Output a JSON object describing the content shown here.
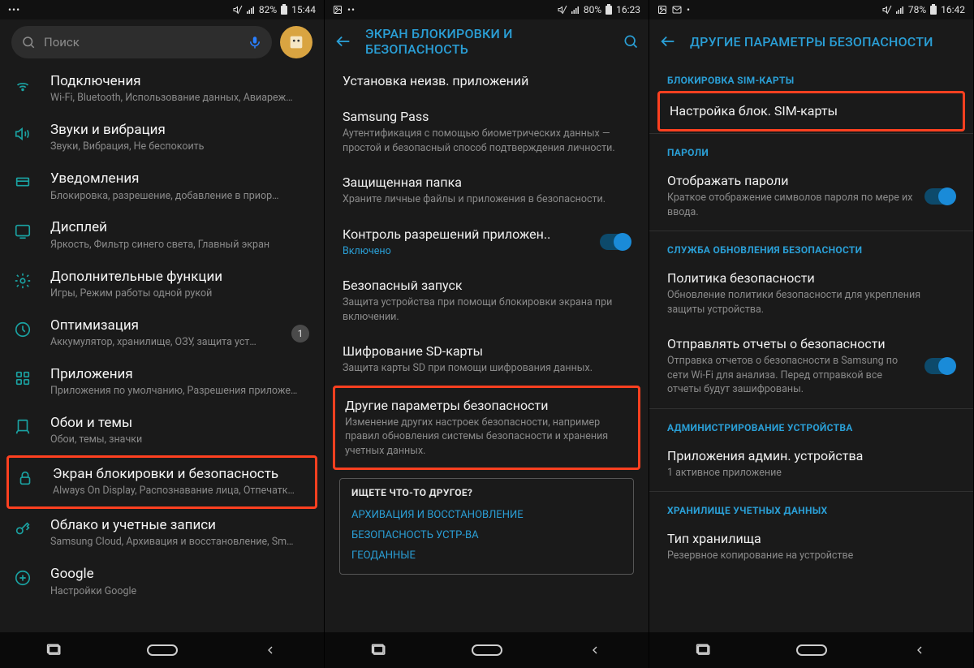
{
  "phone1": {
    "status": {
      "battery": "82%",
      "time": "15:44"
    },
    "search_placeholder": "Поиск",
    "items": [
      {
        "title": "Подключения",
        "sub": "Wi-Fi, Bluetooth, Использование данных, Авиареж…"
      },
      {
        "title": "Звуки и вибрация",
        "sub": "Звуки, Вибрация, Не беспокоить"
      },
      {
        "title": "Уведомления",
        "sub": "Блокировка, разрешение, добавление в приор…"
      },
      {
        "title": "Дисплей",
        "sub": "Яркость, Фильтр синего света, Главный экран"
      },
      {
        "title": "Дополнительные функции",
        "sub": "Игры, Режим работы одной рукой"
      },
      {
        "title": "Оптимизация",
        "sub": "Аккумулятор, хранилище, ОЗУ, защита уст…",
        "badge": "1"
      },
      {
        "title": "Приложения",
        "sub": "Приложения по умолчанию, Разрешения приложе…"
      },
      {
        "title": "Обои и темы",
        "sub": "Обои, темы, значки"
      },
      {
        "title": "Экран блокировки и безопасность",
        "sub": "Always On Display, Распознавание лица, Отпечатк…",
        "hl": true
      },
      {
        "title": "Облако и учетные записи",
        "sub": "Samsung Cloud, Архивация и восстановление, Sm…"
      },
      {
        "title": "Google",
        "sub": "Настройки Google"
      }
    ]
  },
  "phone2": {
    "status": {
      "battery": "80%",
      "time": "16:23"
    },
    "title": "ЭКРАН БЛОКИРОВКИ И БЕЗОПАСНОСТЬ",
    "items": [
      {
        "title": "Установка неизв. приложений"
      },
      {
        "title": "Samsung Pass",
        "sub": "Аутентификация с помощью биометрических данных — простой и безопасный способ подтверждения личности."
      },
      {
        "title": "Защищенная папка",
        "sub": "Храните личные файлы и приложения в безопасности."
      },
      {
        "title": "Контроль разрешений приложен..",
        "sub": "Включено",
        "sub_blue": true,
        "toggle": true
      },
      {
        "title": "Безопасный запуск",
        "sub": "Защита устройства при помощи блокировки экрана при включении."
      },
      {
        "title": "Шифрование SD-карты",
        "sub": "Защита карты SD при помощи шифрования данных."
      },
      {
        "title": "Другие параметры безопасности",
        "sub": "Изменение других настроек безопасности, например правил обновления системы безопасности и хранения учетных данных.",
        "hl": true
      }
    ],
    "other_box": {
      "title": "ИЩЕТЕ ЧТО-ТО ДРУГОЕ?",
      "links": [
        "АРХИВАЦИЯ И ВОССТАНОВЛЕНИЕ",
        "БЕЗОПАСНОСТЬ УСТР-ВА",
        "ГЕОДАННЫЕ"
      ]
    }
  },
  "phone3": {
    "status": {
      "battery": "78%",
      "time": "16:42"
    },
    "title": "ДРУГИЕ ПАРАМЕТРЫ БЕЗОПАСНОСТИ",
    "sections": [
      {
        "header": "БЛОКИРОВКА SIM-КАРТЫ",
        "items": [
          {
            "title": "Настройка блок. SIM-карты",
            "hl": true
          }
        ]
      },
      {
        "header": "ПАРОЛИ",
        "items": [
          {
            "title": "Отображать пароли",
            "sub": "Краткое отображение символов пароля по мере их ввода.",
            "toggle": true
          }
        ]
      },
      {
        "header": "СЛУЖБА ОБНОВЛЕНИЯ БЕЗОПАСНОСТИ",
        "items": [
          {
            "title": "Политика безопасности",
            "sub": "Обновление политики безопасности для укрепления защиты устройства."
          },
          {
            "title": "Отправлять отчеты о безопасности",
            "sub": "Отправка отчетов о безопасности в Samsung по сети Wi-Fi для анализа. Перед отправкой все отчеты будут зашифрованы.",
            "toggle": true
          }
        ]
      },
      {
        "header": "АДМИНИСТРИРОВАНИЕ УСТРОЙСТВА",
        "items": [
          {
            "title": "Приложения админ. устройства",
            "sub": "1 активное приложение"
          }
        ]
      },
      {
        "header": "ХРАНИЛИЩЕ УЧЕТНЫХ ДАННЫХ",
        "items": [
          {
            "title": "Тип хранилища",
            "sub": "Резервное копирование на устройстве"
          }
        ]
      }
    ]
  }
}
